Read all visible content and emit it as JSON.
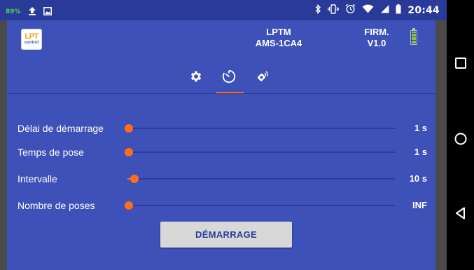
{
  "status_bar": {
    "battery_percent": "89%",
    "time": "20:44"
  },
  "header": {
    "logo": {
      "line1": "LPT",
      "line2": "control"
    },
    "device_label": "LPTM",
    "device_id": "AMS-1CA4",
    "firmware_label": "FIRM.",
    "firmware_version": "V1.0"
  },
  "tabs": [
    {
      "icon": "gear-icon",
      "selected": false
    },
    {
      "icon": "timer-icon",
      "selected": true
    },
    {
      "icon": "remote-icon",
      "selected": false
    }
  ],
  "sliders": [
    {
      "label": "Délai de démarrage",
      "value": "1 s",
      "fraction": 0.0
    },
    {
      "label": "Temps de pose",
      "value": "1 s",
      "fraction": 0.0
    },
    {
      "label": "Intervalle",
      "value": "10 s",
      "fraction": 0.02
    },
    {
      "label": "Nombre de poses",
      "value": "INF",
      "fraction": 0.0
    }
  ],
  "start_button": {
    "label": "DÉMARRAGE"
  },
  "colors": {
    "app_background": "#3e51b8",
    "accent": "#ff6d1a",
    "status_bar": "#2a3a99",
    "button": "#d8d8d8",
    "button_text": "#2c3c95"
  }
}
